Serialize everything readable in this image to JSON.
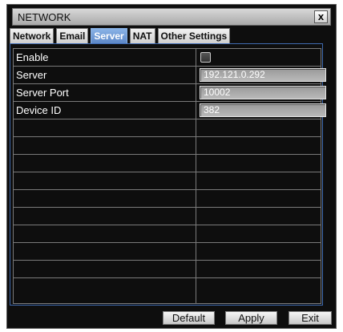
{
  "window": {
    "title": "NETWORK",
    "close_label": "x"
  },
  "tabs": [
    {
      "label": "Network",
      "active": false
    },
    {
      "label": "Email",
      "active": false
    },
    {
      "label": "Server",
      "active": true
    },
    {
      "label": "NAT",
      "active": false
    },
    {
      "label": "Other Settings",
      "active": false
    }
  ],
  "settings": {
    "enable": {
      "label": "Enable",
      "checked": false
    },
    "server": {
      "label": "Server",
      "value": "192.121.0.292"
    },
    "server_port": {
      "label": "Server Port",
      "value": "10002"
    },
    "device_id": {
      "label": "Device ID",
      "value": "382"
    }
  },
  "empty_rows": 10,
  "buttons": {
    "default_label": "Default",
    "apply_label": "Apply",
    "exit_label": "Exit"
  },
  "colors": {
    "background": "#0e0e0e",
    "active_tab": "#6e96d6",
    "panel_border": "#3f6ab0",
    "grid_line": "#7a7a7a"
  }
}
